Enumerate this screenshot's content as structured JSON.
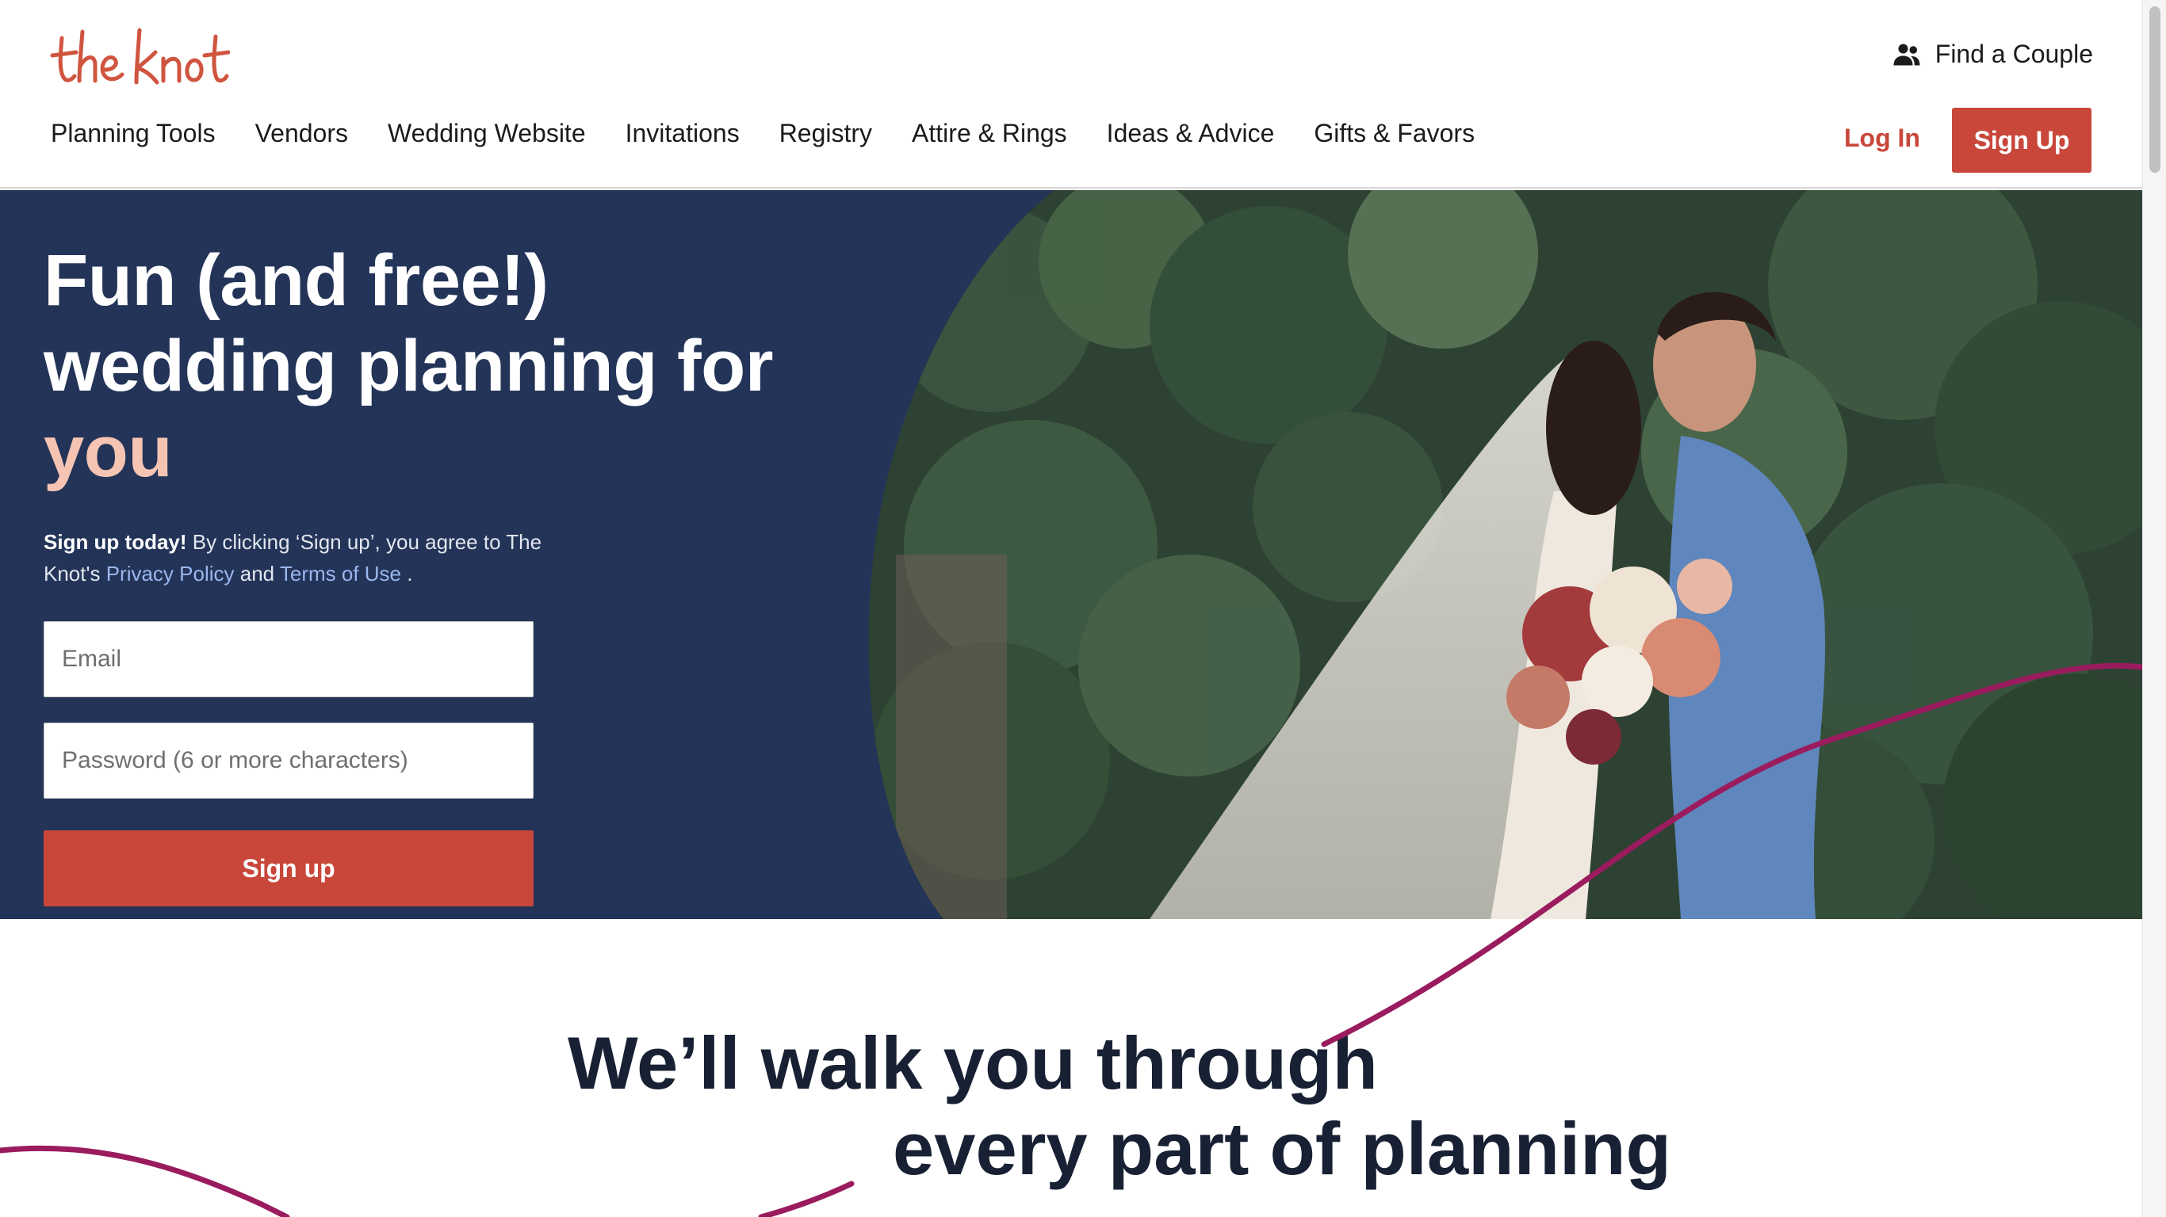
{
  "brand": {
    "logo_text": "the knot",
    "accent": "#c8473a",
    "navy": "#233458",
    "highlight": "#f6c4b3"
  },
  "header": {
    "find_couple": {
      "icon": "people-icon",
      "label": "Find a Couple"
    },
    "nav": [
      {
        "label": "Planning Tools"
      },
      {
        "label": "Vendors"
      },
      {
        "label": "Wedding Website"
      },
      {
        "label": "Invitations"
      },
      {
        "label": "Registry"
      },
      {
        "label": "Attire & Rings"
      },
      {
        "label": "Ideas & Advice"
      },
      {
        "label": "Gifts & Favors"
      }
    ],
    "login_label": "Log In",
    "signup_label": "Sign Up"
  },
  "hero": {
    "title_part1": "Fun (and free!) wedding planning for ",
    "title_accent": "you",
    "terms_bold": "Sign up today!",
    "terms_text1": " By clicking ‘Sign up’, you agree to The Knot's ",
    "privacy_link": "Privacy Policy",
    "terms_and": " and ",
    "terms_link": "Terms of Use",
    "terms_end": " .",
    "email_placeholder": "Email",
    "password_placeholder": "Password (6 or more characters)",
    "signup_button": "Sign up",
    "photo": "wedding-couple-photo"
  },
  "walk": {
    "line1": "We’ll walk you through",
    "line2": "every part of planning",
    "curve_color": "#9a1c5e"
  }
}
